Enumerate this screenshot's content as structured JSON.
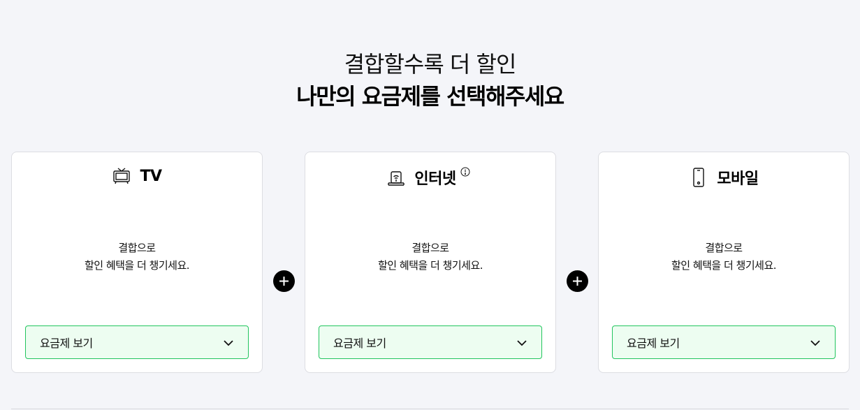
{
  "heading": {
    "subtitle": "결합할수록 더 할인",
    "title": "나만의 요금제를 선택해주세요"
  },
  "cards": [
    {
      "icon": "tv-icon",
      "title": "TV",
      "desc_line1": "결합으로",
      "desc_line2": "할인 혜택을 더 챙기세요.",
      "button_label": "요금제 보기"
    },
    {
      "icon": "router-icon",
      "title": "인터넷",
      "has_info": true,
      "desc_line1": "결합으로",
      "desc_line2": "할인 혜택을 더 챙기세요.",
      "button_label": "요금제 보기"
    },
    {
      "icon": "mobile-icon",
      "title": "모바일",
      "desc_line1": "결합으로",
      "desc_line2": "할인 혜택을 더 챙기세요.",
      "button_label": "요금제 보기"
    }
  ],
  "colors": {
    "background": "#f4f5f9",
    "button_bg": "#edfdf1",
    "button_border": "#22c55e"
  }
}
